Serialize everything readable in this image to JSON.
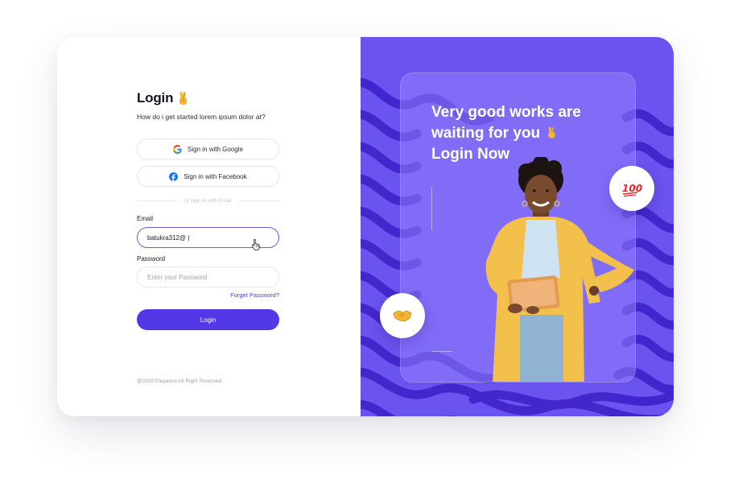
{
  "login": {
    "title": "Login",
    "subtitle": "How do i get started lorem ipsum dolor at?",
    "google_label": "Sign in with Google",
    "facebook_label": "Sign in with Facebook",
    "divider_text": "or Sign in with Email",
    "email_label": "Email",
    "email_value": "batukra312@ |",
    "password_label": "Password",
    "password_placeholder": "Enter your Password",
    "forgot_label": "Forget Password?",
    "login_button": "Login",
    "copyright": "@2020 Elegance All Right Reserved."
  },
  "promo": {
    "line1": "Very good works are",
    "line2": "waiting for you",
    "line3": "Login Now",
    "badge_emoji": "100"
  },
  "colors": {
    "accent": "#5338e8",
    "panel": "#6a53ee",
    "wave": "#3f22c9",
    "email_border": "#6c5ce7"
  },
  "icons": [
    "google-icon",
    "facebook-icon",
    "crossed-fingers-icon",
    "hundred-points-icon",
    "handshake-icon",
    "hand-cursor-icon"
  ]
}
